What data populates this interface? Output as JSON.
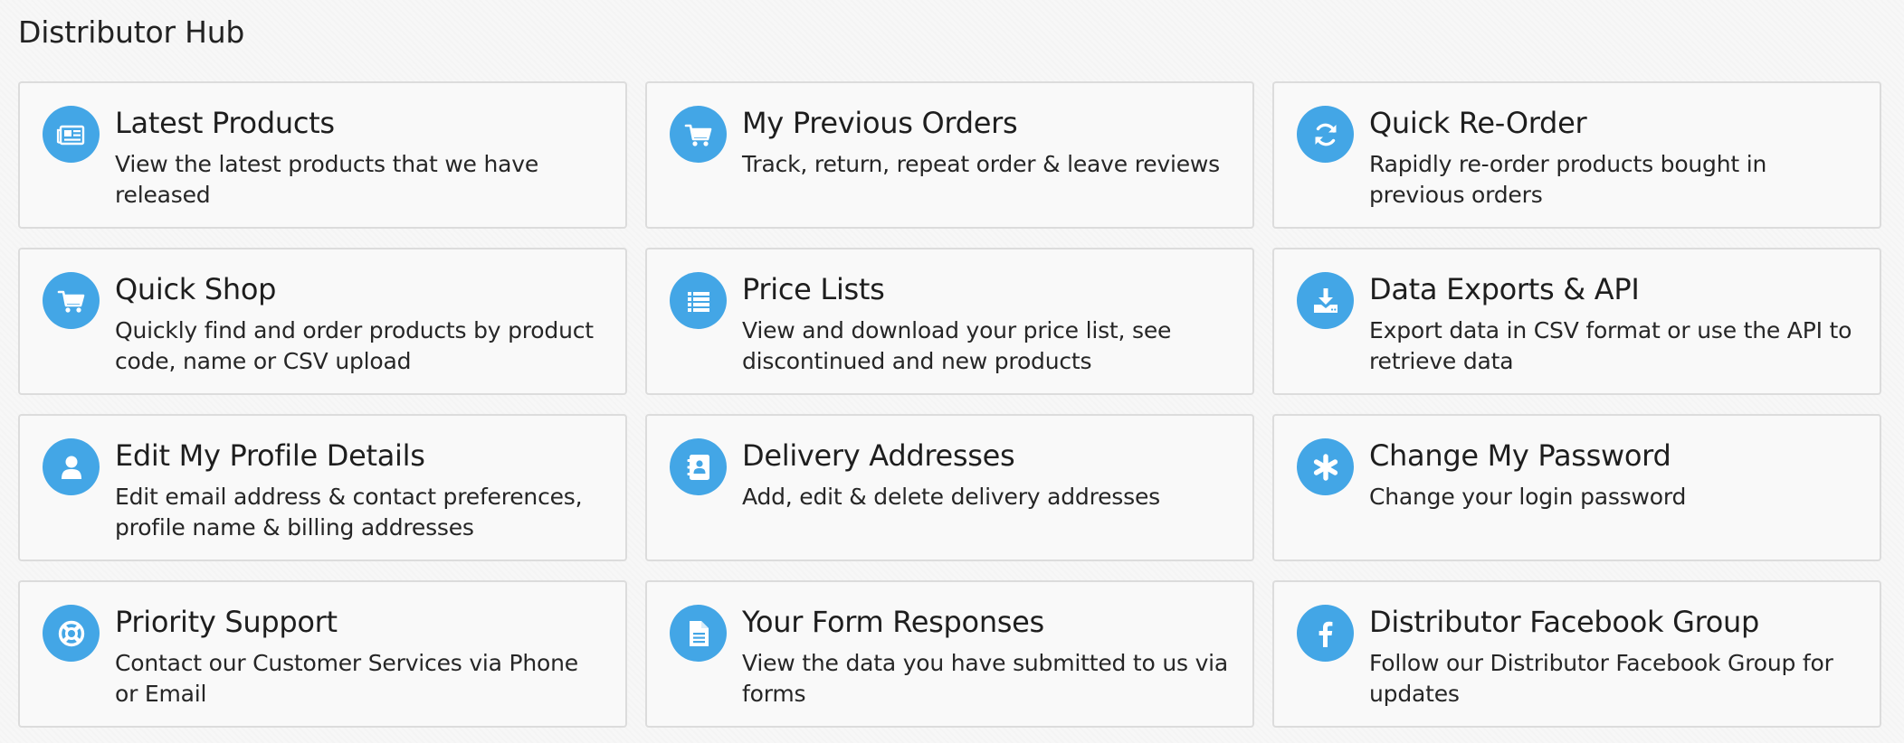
{
  "page": {
    "title": "Distributor Hub"
  },
  "colors": {
    "accent": "#43a6e6",
    "card_border": "#dcdcdc",
    "background": "#f7f7f7"
  },
  "cards": [
    {
      "title": "Latest Products",
      "description": "View the latest products that we have released",
      "icon": "newspaper-icon"
    },
    {
      "title": "My Previous Orders",
      "description": "Track, return, repeat order & leave reviews",
      "icon": "shopping-cart-icon"
    },
    {
      "title": "Quick Re-Order",
      "description": "Rapidly re-order products bought in previous orders",
      "icon": "refresh-icon"
    },
    {
      "title": "Quick Shop",
      "description": "Quickly find and order products by product code, name or CSV upload",
      "icon": "cart-icon"
    },
    {
      "title": "Price Lists",
      "description": "View and download your price list, see discontinued and new products",
      "icon": "list-icon"
    },
    {
      "title": "Data Exports & API",
      "description": "Export data in CSV format or use the API to retrieve data",
      "icon": "download-icon"
    },
    {
      "title": "Edit My Profile Details",
      "description": "Edit email address & contact preferences, profile name & billing addresses",
      "icon": "user-icon"
    },
    {
      "title": "Delivery Addresses",
      "description": "Add, edit & delete delivery addresses",
      "icon": "address-book-icon"
    },
    {
      "title": "Change My Password",
      "description": "Change your login password",
      "icon": "asterisk-icon"
    },
    {
      "title": "Priority Support",
      "description": "Contact our Customer Services via Phone or Email",
      "icon": "life-ring-icon"
    },
    {
      "title": "Your Form Responses",
      "description": "View the data you have submitted to us via forms",
      "icon": "document-icon"
    },
    {
      "title": "Distributor Facebook Group",
      "description": "Follow our Distributor Facebook Group for updates",
      "icon": "facebook-icon"
    }
  ]
}
